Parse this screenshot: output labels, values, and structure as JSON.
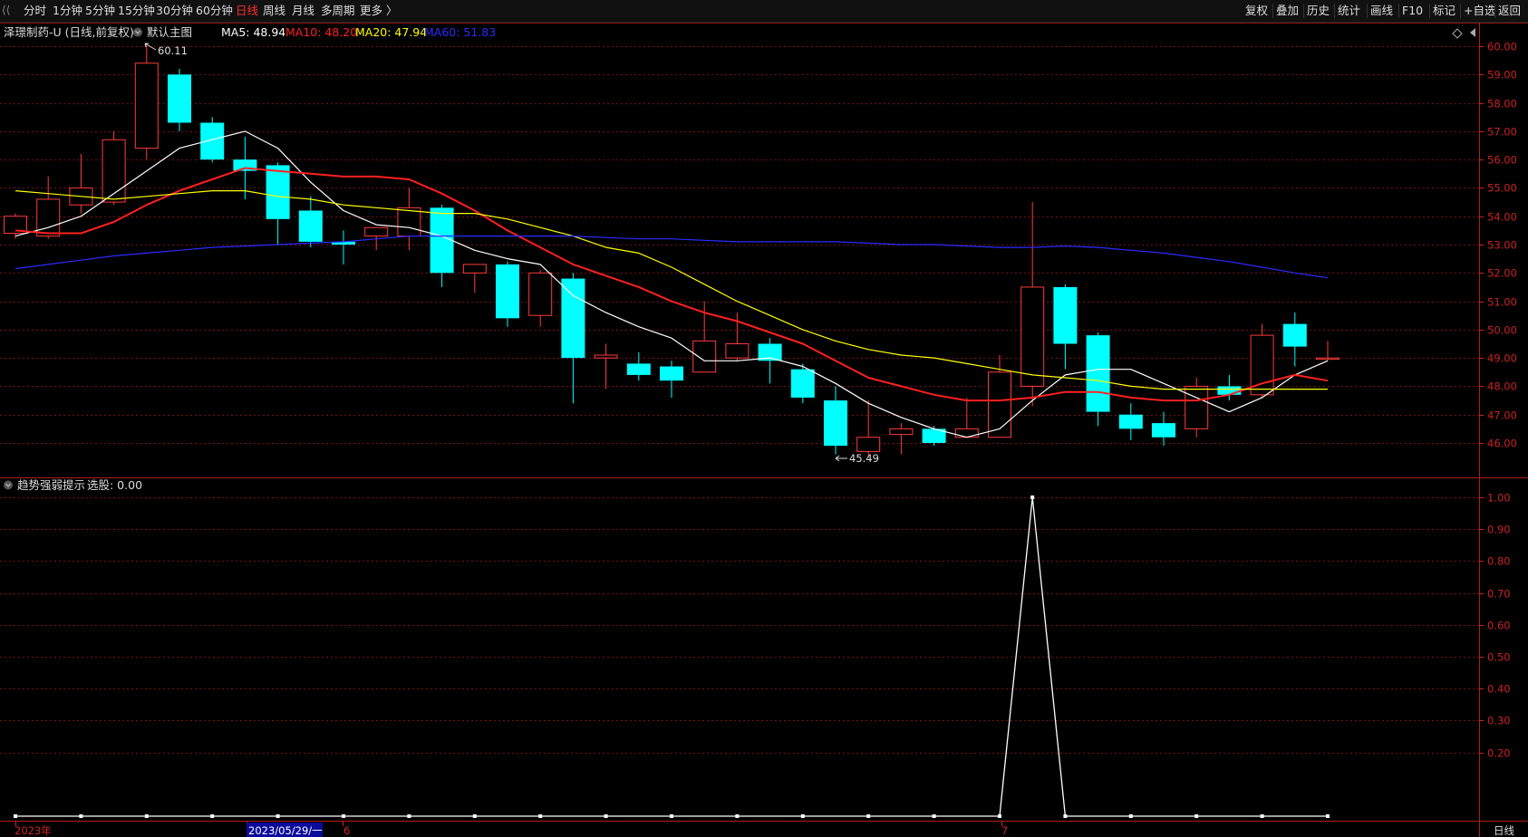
{
  "toolbar": {
    "periods": [
      "分时",
      "1分钟",
      "5分钟",
      "15分钟",
      "30分钟",
      "60分钟",
      "日线",
      "周线",
      "月线",
      "多周期",
      "更多 〉"
    ],
    "active_period": "日线",
    "right_buttons": [
      "复权",
      "叠加",
      "历史",
      "统计",
      "画线",
      "F10",
      "标记",
      "+自选",
      "返回"
    ]
  },
  "main_panel": {
    "stock_title": "泽璟制药-U (日线,前复权)",
    "main_chart_label": "默认主图",
    "ma_labels": [
      {
        "text": "MA5: 48.94",
        "color": "#ffffff"
      },
      {
        "text": "MA10: 48.20",
        "color": "#ff2020"
      },
      {
        "text": "MA20: 47.94",
        "color": "#ffff00"
      },
      {
        "text": "MA60: 51.83",
        "color": "#2b2bff"
      }
    ],
    "high_label": "60.11",
    "low_label": "45.49"
  },
  "sub_panel": {
    "indicator_name": "趋势强弱提示",
    "indicator_value": "选股: 0.00"
  },
  "x_axis": {
    "labels": [
      "2023年",
      "2023/05/29/一",
      "6",
      "7"
    ],
    "period_label": "日线"
  },
  "colors": {
    "up": "#ff3b3b",
    "down": "#00ffff",
    "ma5": "#ffffff",
    "ma10": "#ff2020",
    "ma20": "#ffff00",
    "ma60": "#2b2bff",
    "grid": "#7a1010",
    "axis_text": "#cc2222"
  },
  "chart_data": [
    {
      "type": "candlestick",
      "title": "泽璟制药-U (日线,前复权)",
      "ylim": [
        45.5,
        60.5
      ],
      "y_ticks": [
        60.0,
        59.0,
        58.0,
        57.0,
        56.0,
        55.0,
        54.0,
        53.0,
        52.0,
        51.0,
        50.0,
        49.0,
        48.0,
        47.0,
        46.0
      ],
      "candles": [
        {
          "o": 53.4,
          "h": 54.1,
          "l": 53.2,
          "c": 54.0
        },
        {
          "o": 53.3,
          "h": 55.4,
          "l": 53.2,
          "c": 54.6
        },
        {
          "o": 54.4,
          "h": 56.2,
          "l": 54.1,
          "c": 55.0
        },
        {
          "o": 54.5,
          "h": 57.0,
          "l": 54.4,
          "c": 56.7
        },
        {
          "o": 56.4,
          "h": 60.11,
          "l": 56.0,
          "c": 59.4
        },
        {
          "o": 59.0,
          "h": 59.2,
          "l": 57.0,
          "c": 57.3
        },
        {
          "o": 57.3,
          "h": 57.5,
          "l": 55.9,
          "c": 56.0
        },
        {
          "o": 56.0,
          "h": 56.8,
          "l": 54.6,
          "c": 55.6
        },
        {
          "o": 55.8,
          "h": 55.9,
          "l": 53.0,
          "c": 53.9
        },
        {
          "o": 54.2,
          "h": 54.7,
          "l": 52.9,
          "c": 53.1
        },
        {
          "o": 53.1,
          "h": 53.5,
          "l": 52.3,
          "c": 53.0
        },
        {
          "o": 53.3,
          "h": 53.6,
          "l": 52.8,
          "c": 53.6
        },
        {
          "o": 53.3,
          "h": 55.0,
          "l": 52.8,
          "c": 54.3
        },
        {
          "o": 54.3,
          "h": 54.4,
          "l": 51.5,
          "c": 52.0
        },
        {
          "o": 52.0,
          "h": 52.3,
          "l": 51.3,
          "c": 52.3
        },
        {
          "o": 52.3,
          "h": 52.4,
          "l": 50.1,
          "c": 50.4
        },
        {
          "o": 50.5,
          "h": 52.1,
          "l": 50.1,
          "c": 52.0
        },
        {
          "o": 51.8,
          "h": 52.0,
          "l": 47.4,
          "c": 49.0
        },
        {
          "o": 49.0,
          "h": 49.5,
          "l": 47.9,
          "c": 49.1
        },
        {
          "o": 48.8,
          "h": 49.2,
          "l": 48.2,
          "c": 48.4
        },
        {
          "o": 48.7,
          "h": 48.9,
          "l": 47.6,
          "c": 48.2
        },
        {
          "o": 48.5,
          "h": 51.0,
          "l": 48.5,
          "c": 49.6
        },
        {
          "o": 49.0,
          "h": 50.6,
          "l": 48.9,
          "c": 49.5
        },
        {
          "o": 49.5,
          "h": 49.7,
          "l": 48.1,
          "c": 48.9
        },
        {
          "o": 48.6,
          "h": 48.8,
          "l": 47.4,
          "c": 47.6
        },
        {
          "o": 47.5,
          "h": 48.0,
          "l": 45.6,
          "c": 45.9
        },
        {
          "o": 45.7,
          "h": 47.5,
          "l": 45.49,
          "c": 46.2
        },
        {
          "o": 46.3,
          "h": 46.7,
          "l": 45.6,
          "c": 46.5
        },
        {
          "o": 46.5,
          "h": 46.6,
          "l": 45.9,
          "c": 46.0
        },
        {
          "o": 46.2,
          "h": 47.6,
          "l": 46.2,
          "c": 46.5
        },
        {
          "o": 46.2,
          "h": 49.1,
          "l": 46.2,
          "c": 48.5
        },
        {
          "o": 48.0,
          "h": 54.5,
          "l": 47.3,
          "c": 51.5
        },
        {
          "o": 51.5,
          "h": 51.6,
          "l": 48.6,
          "c": 49.5
        },
        {
          "o": 49.8,
          "h": 49.9,
          "l": 46.6,
          "c": 47.1
        },
        {
          "o": 47.0,
          "h": 47.4,
          "l": 46.1,
          "c": 46.5
        },
        {
          "o": 46.7,
          "h": 47.1,
          "l": 45.9,
          "c": 46.2
        },
        {
          "o": 46.5,
          "h": 48.3,
          "l": 46.2,
          "c": 48.0
        },
        {
          "o": 48.0,
          "h": 48.4,
          "l": 47.5,
          "c": 47.7
        },
        {
          "o": 47.7,
          "h": 50.2,
          "l": 47.6,
          "c": 49.8
        },
        {
          "o": 50.2,
          "h": 50.6,
          "l": 48.7,
          "c": 49.4
        },
        {
          "o": 49.0,
          "h": 49.6,
          "l": 48.9,
          "c": 49.0
        }
      ],
      "series": [
        {
          "name": "MA5",
          "values": [
            53.3,
            53.6,
            54.0,
            54.8,
            55.6,
            56.4,
            56.7,
            57.0,
            56.4,
            55.2,
            54.2,
            53.7,
            53.6,
            53.3,
            52.8,
            52.5,
            52.3,
            51.2,
            50.6,
            50.1,
            49.7,
            48.9,
            48.9,
            49.0,
            48.7,
            48.1,
            47.4,
            46.9,
            46.5,
            46.2,
            46.5,
            47.5,
            48.4,
            48.6,
            48.6,
            48.1,
            47.6,
            47.1,
            47.6,
            48.4,
            48.9
          ]
        },
        {
          "name": "MA10",
          "values": [
            53.5,
            53.4,
            53.4,
            53.8,
            54.4,
            54.9,
            55.3,
            55.7,
            55.6,
            55.5,
            55.4,
            55.4,
            55.3,
            54.8,
            54.2,
            53.5,
            52.9,
            52.3,
            51.9,
            51.5,
            51.0,
            50.6,
            50.3,
            49.9,
            49.5,
            48.9,
            48.3,
            48.0,
            47.7,
            47.5,
            47.5,
            47.6,
            47.8,
            47.8,
            47.6,
            47.5,
            47.5,
            47.7,
            48.1,
            48.4,
            48.2
          ]
        },
        {
          "name": "MA20",
          "values": [
            54.9,
            54.8,
            54.7,
            54.6,
            54.7,
            54.8,
            54.9,
            54.9,
            54.7,
            54.6,
            54.4,
            54.3,
            54.2,
            54.1,
            54.1,
            53.9,
            53.6,
            53.3,
            52.9,
            52.7,
            52.2,
            51.6,
            51.0,
            50.5,
            50.0,
            49.6,
            49.3,
            49.1,
            49.0,
            48.8,
            48.6,
            48.4,
            48.3,
            48.2,
            48.0,
            47.9,
            47.9,
            47.9,
            47.9,
            47.9,
            47.9
          ]
        },
        {
          "name": "MA60",
          "values": [
            52.15,
            52.3,
            52.45,
            52.6,
            52.7,
            52.8,
            52.9,
            52.95,
            53.0,
            53.05,
            53.1,
            53.2,
            53.3,
            53.3,
            53.3,
            53.3,
            53.3,
            53.3,
            53.25,
            53.2,
            53.2,
            53.15,
            53.1,
            53.1,
            53.1,
            53.1,
            53.05,
            53.0,
            53.0,
            52.95,
            52.9,
            52.9,
            52.95,
            52.9,
            52.8,
            52.7,
            52.55,
            52.4,
            52.2,
            52.0,
            51.83
          ]
        }
      ]
    },
    {
      "type": "line",
      "title": "趋势强弱提示",
      "ylim": [
        0.0,
        1.0
      ],
      "y_ticks": [
        1.0,
        0.9,
        0.8,
        0.7,
        0.6,
        0.5,
        0.4,
        0.3,
        0.2
      ],
      "series": [
        {
          "name": "选股",
          "values": [
            0,
            0,
            0,
            0,
            0,
            0,
            0,
            0,
            0,
            0,
            0,
            0,
            0,
            0,
            0,
            0,
            0,
            0,
            0,
            0,
            0,
            0,
            0,
            0,
            0,
            0,
            0,
            0,
            0,
            0,
            0,
            1,
            0,
            0,
            0,
            0,
            0,
            0,
            0,
            0,
            0
          ]
        }
      ]
    }
  ]
}
